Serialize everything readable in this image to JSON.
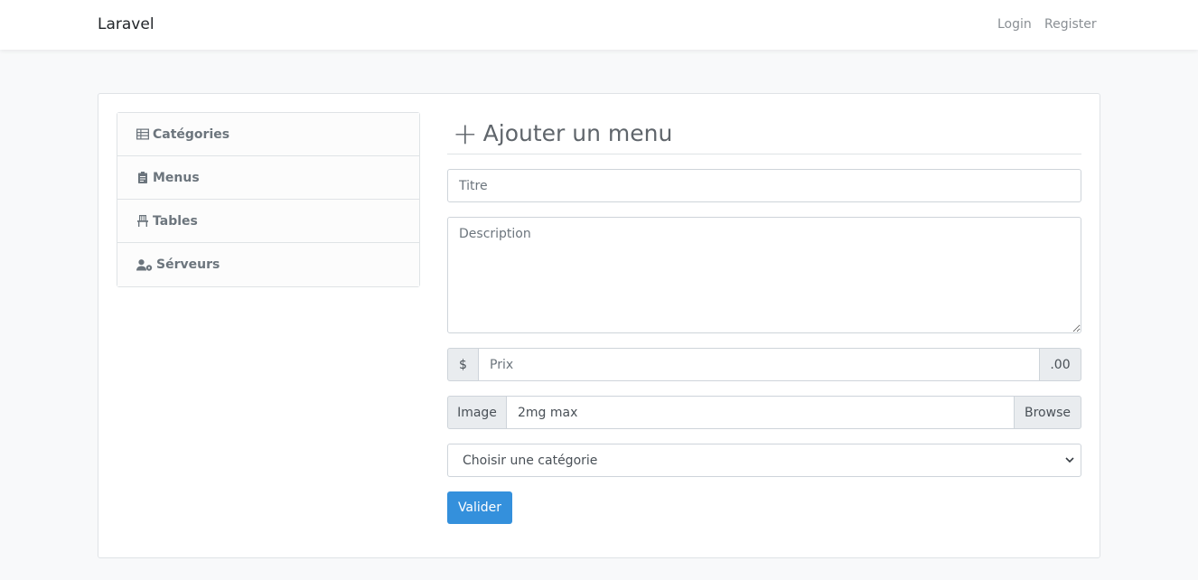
{
  "navbar": {
    "brand": "Laravel",
    "login": "Login",
    "register": "Register"
  },
  "sidebar": {
    "items": [
      {
        "label": "Catégories",
        "icon": "table-icon"
      },
      {
        "label": "Menus",
        "icon": "clipboard-icon"
      },
      {
        "label": "Tables",
        "icon": "chair-icon"
      },
      {
        "label": "Sérveurs",
        "icon": "user-cog-icon"
      }
    ]
  },
  "form": {
    "heading": "Ajouter un menu",
    "titre_placeholder": "Titre",
    "description_placeholder": "Description",
    "prix": {
      "prefix": "$",
      "placeholder": "Prix",
      "suffix": ".00"
    },
    "image": {
      "label": "Image",
      "text": "2mg max",
      "browse": "Browse"
    },
    "category_select": "Choisir une catégorie",
    "submit": "Valider"
  },
  "colors": {
    "accent": "#3490dc",
    "background": "#f8f9fa"
  }
}
